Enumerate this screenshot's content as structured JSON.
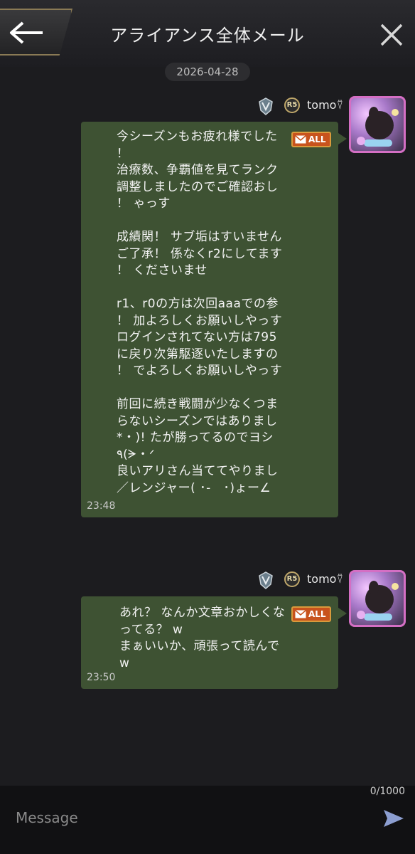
{
  "header": {
    "title": "アライアンス全体メール"
  },
  "date_label": "2026-04-28",
  "messages": [
    {
      "username": "tomo⍢",
      "rank": "R5",
      "badge": "ALL",
      "text": "今シーズンもお疲れ様でした\n！\n治療数、争覇値を見てランク\n調整しましたのでご確認おし\n！ ゃっす\n\n成績関！ サブ垢はすいません\nご了承！ 係なくr2にしてます\n！ くださいませ\n\nr1、r0の方は次回aaaでの参\n！ 加よろしくお願いしやっす\nログインされてない方は795\nに戻り次第駆逐いたしますの\n！ でよろしくお願いしやっす\n\n前回に続き戦闘が少なくつま\nらないシーズンではありまし\n*・)! たが勝ってるのでヨシ\n٩(ᗒ・ᐟ\n良いアリさん当ててやりまし\n／レンジャー( ･-　･)ょー∠",
      "time": "23:48"
    },
    {
      "username": "tomo⍢",
      "rank": "R5",
      "badge": "ALL",
      "text": "あれ？ なんか文章おかしくな\nってる？ w\nまぁいいか、頑張って読んで\nw",
      "time": "23:50"
    }
  ],
  "composer": {
    "counter": "0/1000",
    "placeholder": "Message"
  },
  "colors": {
    "bubble": "#3e5233",
    "background": "#1c1c1f",
    "badge": "#c8531d",
    "accent": "#bfa76a"
  },
  "icons": [
    "back-arrow-icon",
    "close-icon",
    "alliance-emblem-icon",
    "rank-badge-icon",
    "mail-icon",
    "send-icon"
  ]
}
